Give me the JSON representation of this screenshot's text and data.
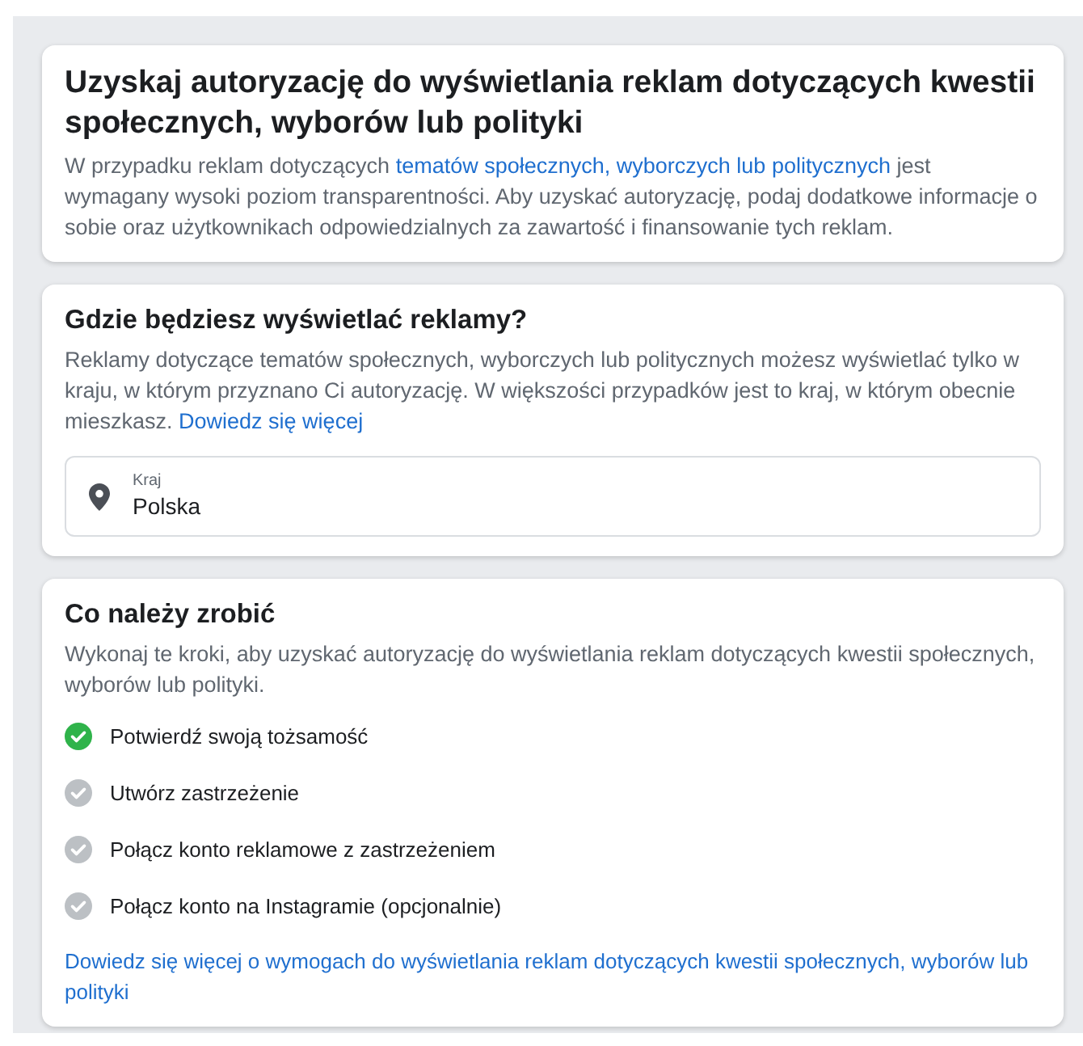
{
  "intro": {
    "title": "Uzyskaj autoryzację do wyświetlania reklam dotyczących kwestii społecznych, wyborów lub polityki",
    "text_before": "W przypadku reklam dotyczących",
    "link": "tematów społecznych, wyborczych lub politycznych",
    "text_after": "jest wymagany wysoki poziom transparentności. Aby uzyskać autoryzację, podaj dodatkowe informacje o sobie oraz użytkownikach odpowiedzialnych za zawartość i finansowanie tych reklam."
  },
  "location": {
    "title": "Gdzie będziesz wyświetlać reklamy?",
    "text": "Reklamy dotyczące tematów społecznych, wyborczych lub politycznych możesz wyświetlać tylko w kraju, w którym przyznano Ci autoryzację. W większości przypadków jest to kraj, w którym obecnie mieszkasz.",
    "link": "Dowiedz się więcej",
    "field_label": "Kraj",
    "field_value": "Polska"
  },
  "todo": {
    "title": "Co należy zrobić",
    "text": "Wykonaj te kroki, aby uzyskać autoryzację do wyświetlania reklam dotyczących kwestii społecznych, wyborów lub polityki.",
    "steps": [
      {
        "label": "Potwierdź swoją tożsamość",
        "done": true
      },
      {
        "label": "Utwórz zastrzeżenie",
        "done": false
      },
      {
        "label": "Połącz konto reklamowe z zastrzeżeniem",
        "done": false
      },
      {
        "label": "Połącz konto na Instagramie (opcjonalnie)",
        "done": false
      }
    ],
    "link": "Dowiedz się więcej o wymogach do wyświetlania reklam dotyczących kwestii społecznych, wyborów lub polityki"
  }
}
